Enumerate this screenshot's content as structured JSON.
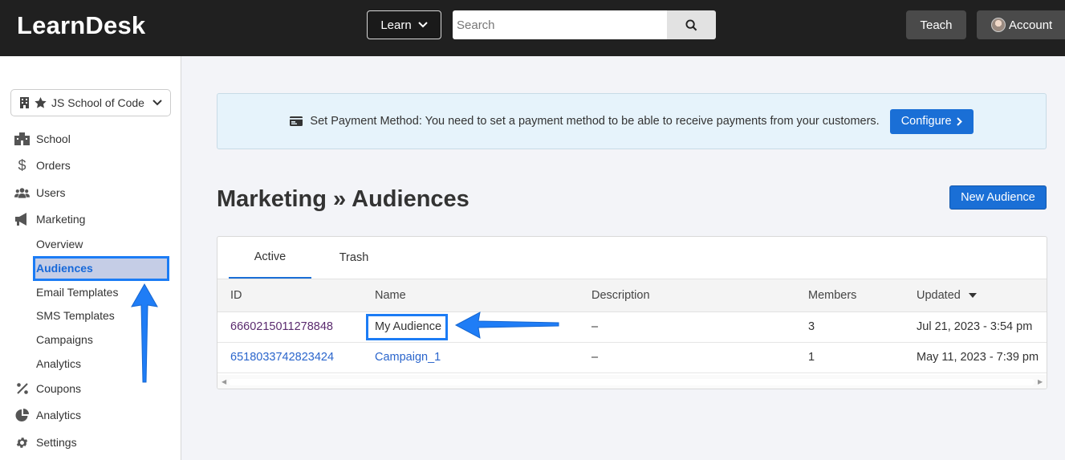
{
  "app": {
    "title": "LearnDesk"
  },
  "topbar": {
    "learn_label": "Learn",
    "search_placeholder": "Search",
    "teach_label": "Teach",
    "account_label": "Account"
  },
  "sidebar": {
    "school_name": "JS School of Code",
    "items": [
      {
        "label": "School",
        "icon": "building-icon"
      },
      {
        "label": "Orders",
        "icon": "dollar-icon"
      },
      {
        "label": "Users",
        "icon": "users-icon"
      },
      {
        "label": "Marketing",
        "icon": "megaphone-icon"
      }
    ],
    "marketing_sub": [
      "Overview",
      "Audiences",
      "Email Templates",
      "SMS Templates",
      "Campaigns",
      "Analytics"
    ],
    "items_after": [
      {
        "label": "Coupons",
        "icon": "percent-icon"
      },
      {
        "label": "Analytics",
        "icon": "pie-chart-icon"
      },
      {
        "label": "Settings",
        "icon": "gear-icon"
      }
    ]
  },
  "banner": {
    "text": "Set Payment Method: You need to set a payment method to be able to receive payments from your customers.",
    "button_label": "Configure"
  },
  "page": {
    "title": "Marketing » Audiences",
    "new_button_label": "New Audience"
  },
  "tabs": [
    "Active",
    "Trash"
  ],
  "table": {
    "columns": [
      "ID",
      "Name",
      "Description",
      "Members",
      "Updated"
    ],
    "rows": [
      {
        "id": "6660215011278848",
        "name": "My Audience",
        "description": "–",
        "members": "3",
        "updated": "Jul 21, 2023 - 3:54 pm"
      },
      {
        "id": "6518033742823424",
        "name": "Campaign_1",
        "description": "–",
        "members": "1",
        "updated": "May 11, 2023 - 7:39 pm"
      }
    ]
  },
  "colors": {
    "accent": "#1a6fd6",
    "highlight": "#1c7cf5",
    "topbar": "#202020"
  }
}
